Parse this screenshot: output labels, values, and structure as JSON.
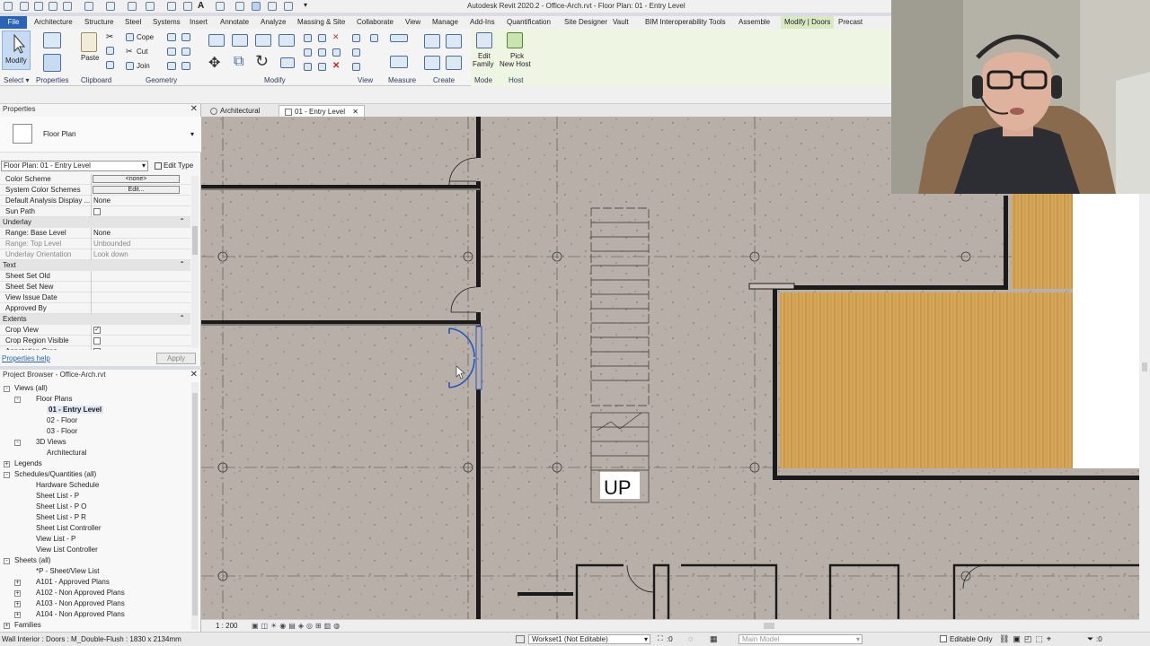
{
  "titlebar": {
    "title": "Autodesk Revit 2020.2 - Office-Arch.rvt - Floor Plan: 01 - Entry Level"
  },
  "ribbon_tabs": [
    "File",
    "Architecture",
    "Structure",
    "Steel",
    "Systems",
    "Insert",
    "Annotate",
    "Analyze",
    "Massing & Site",
    "Collaborate",
    "View",
    "Manage",
    "Add-Ins",
    "Quantification",
    "Site Designer",
    "Vault",
    "BIM Interoperability Tools",
    "Assemble",
    "Modify | Doors",
    "Precast"
  ],
  "ribbon": {
    "modify_label": "Modify",
    "paste_label": "Paste",
    "cope_label": "Cope",
    "cut_label": "Cut",
    "join_label": "Join",
    "edit_family_label_1": "Edit",
    "edit_family_label_2": "Family",
    "pick_host_label_1": "Pick",
    "pick_host_label_2": "New Host",
    "panels": {
      "select": "Select",
      "properties": "Properties",
      "clipboard": "Clipboard",
      "geometry": "Geometry",
      "modify": "Modify",
      "view": "View",
      "measure": "Measure",
      "create": "Create",
      "mode": "Mode",
      "host": "Host"
    }
  },
  "properties": {
    "title": "Properties",
    "type_name": "Floor Plan",
    "instance_selector": "Floor Plan: 01 - Entry Level",
    "edit_type": "Edit Type",
    "rows": [
      {
        "kind": "row",
        "key": "Color Scheme",
        "value": "<none>",
        "control": "button"
      },
      {
        "kind": "row",
        "key": "System Color Schemes",
        "value": "Edit...",
        "control": "button"
      },
      {
        "kind": "row",
        "key": "Default Analysis Display ...",
        "value": "None"
      },
      {
        "kind": "row",
        "key": "Sun Path",
        "value": "",
        "control": "checkbox",
        "checked": false
      },
      {
        "kind": "cat",
        "key": "Underlay"
      },
      {
        "kind": "row",
        "key": "Range: Base Level",
        "value": "None"
      },
      {
        "kind": "row",
        "key": "Range: Top Level",
        "value": "Unbounded",
        "grey": true
      },
      {
        "kind": "row",
        "key": "Underlay Orientation",
        "value": "Look down",
        "grey": true
      },
      {
        "kind": "cat",
        "key": "Text"
      },
      {
        "kind": "row",
        "key": "Sheet Set Old",
        "value": ""
      },
      {
        "kind": "row",
        "key": "Sheet Set New",
        "value": ""
      },
      {
        "kind": "row",
        "key": "View Issue Date",
        "value": ""
      },
      {
        "kind": "row",
        "key": "Approved By",
        "value": ""
      },
      {
        "kind": "cat",
        "key": "Extents"
      },
      {
        "kind": "row",
        "key": "Crop View",
        "value": "",
        "control": "checkbox",
        "checked": true
      },
      {
        "kind": "row",
        "key": "Crop Region Visible",
        "value": "",
        "control": "checkbox",
        "checked": false
      },
      {
        "kind": "row",
        "key": "Annotation Crop",
        "value": "",
        "control": "checkbox",
        "checked": false
      }
    ],
    "help_link": "Properties help",
    "apply": "Apply"
  },
  "browser": {
    "title": "Project Browser - Office-Arch.rvt",
    "items": [
      {
        "label": "Views (all)",
        "depth": 0,
        "exp": "-"
      },
      {
        "label": "Floor Plans",
        "depth": 1,
        "exp": "-"
      },
      {
        "label": "01 - Entry Level",
        "depth": 2,
        "selected": true
      },
      {
        "label": "02 - Floor",
        "depth": 2
      },
      {
        "label": "03 - Floor",
        "depth": 2
      },
      {
        "label": "3D Views",
        "depth": 1,
        "exp": "-"
      },
      {
        "label": "Architectural",
        "depth": 2
      },
      {
        "label": "Legends",
        "depth": 0,
        "exp": "+"
      },
      {
        "label": "Schedules/Quantities (all)",
        "depth": 0,
        "exp": "-"
      },
      {
        "label": "Hardware Schedule",
        "depth": 1
      },
      {
        "label": "Sheet List - P",
        "depth": 1
      },
      {
        "label": "Sheet List - P O",
        "depth": 1
      },
      {
        "label": "Sheet List - P R",
        "depth": 1
      },
      {
        "label": "Sheet List Controller",
        "depth": 1
      },
      {
        "label": "View List - P",
        "depth": 1
      },
      {
        "label": "View List Controller",
        "depth": 1
      },
      {
        "label": "Sheets (all)",
        "depth": 0,
        "exp": "-"
      },
      {
        "label": "*P - Sheet/View List",
        "depth": 1
      },
      {
        "label": "A101 - Approved Plans",
        "depth": 1,
        "exp": "+"
      },
      {
        "label": "A102 - Non Approved Plans",
        "depth": 1,
        "exp": "+"
      },
      {
        "label": "A103 - Non Approved Plans",
        "depth": 1,
        "exp": "+"
      },
      {
        "label": "A104 - Non Approved Plans",
        "depth": 1,
        "exp": "+"
      },
      {
        "label": "Families",
        "depth": 0,
        "exp": "+"
      }
    ]
  },
  "view_tabs": [
    {
      "label": "Architectural",
      "active": false
    },
    {
      "label": "01 - Entry Level",
      "active": true
    }
  ],
  "canvas": {
    "stair_label": "UP"
  },
  "viewbar": {
    "scale": "1 : 200"
  },
  "statusbar": {
    "status": "Wall Interior : Doors : M_Double-Flush : 1830 x 2134mm",
    "status_shown": "Wall Interior : Doors : M_Double-Flush : 1830 x 2134mm",
    "workset": "Workset1 (Not Editable)",
    "count": ":0",
    "design_option": "Main Model",
    "editable_only": "Editable Only",
    "filter": ":0"
  },
  "colors": {
    "canvas": "#b8b0a8",
    "wood": "#d8a85a",
    "accent": "#2b63b6",
    "context_tab": "#d9e9c4"
  }
}
